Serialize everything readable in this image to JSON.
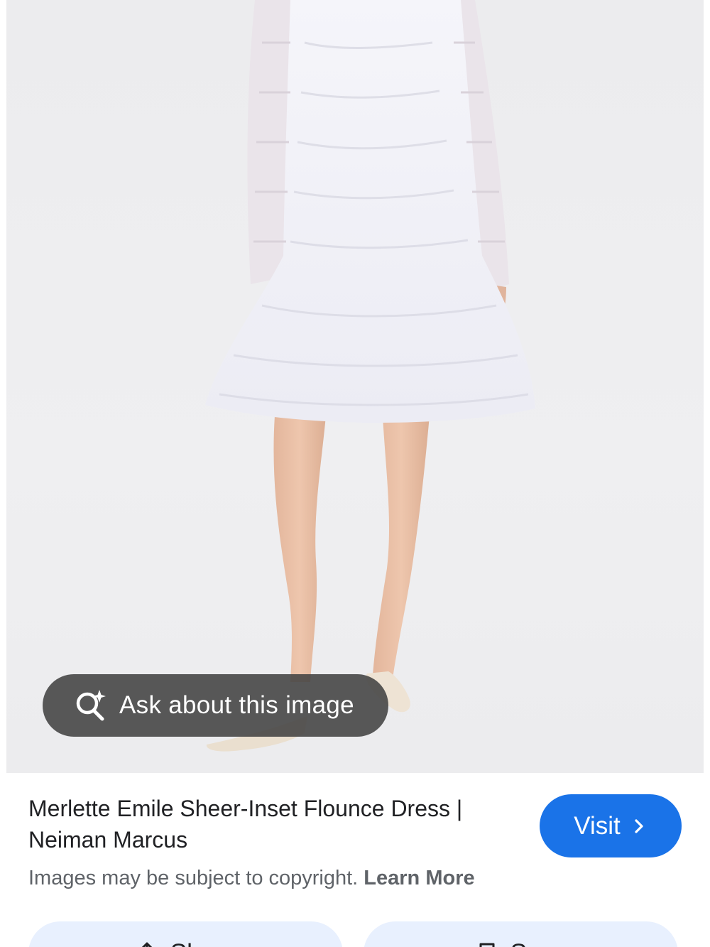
{
  "image": {
    "description_icon": "photo-of-dress",
    "ask_button": {
      "label": "Ask about this image",
      "icon": "lens-sparkle-icon"
    }
  },
  "result": {
    "title": "Merlette Emile Sheer-Inset Flounce Dress | Neiman Marcus",
    "visit_label": "Visit",
    "visit_icon": "chevron-right-icon",
    "copyright_text": "Images may be subject to copyright.",
    "learn_more_label": "Learn More"
  },
  "actions": {
    "share_label": "Share",
    "share_icon": "share-icon",
    "save_label": "Save",
    "save_icon": "bookmark-icon"
  },
  "colors": {
    "accent": "#1a73e8",
    "pill_bg": "#424242",
    "action_bg": "#e8f0fe",
    "text_primary": "#202124",
    "text_secondary": "#5f6368"
  }
}
